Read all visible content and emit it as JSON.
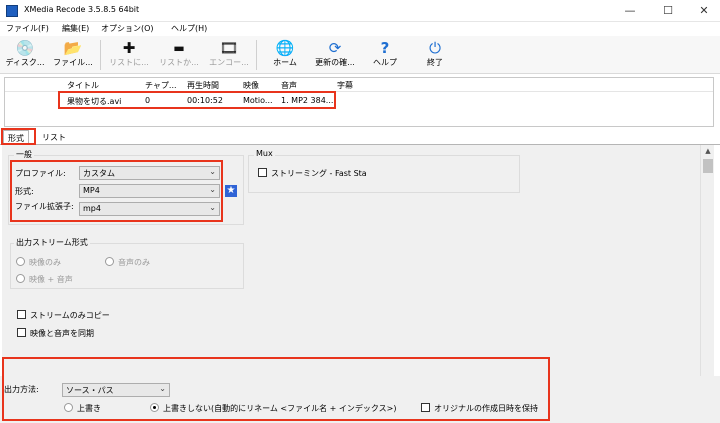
{
  "window": {
    "title": "XMedia Recode 3.5.8.5 64bit",
    "minimize": "—",
    "maximize": "☐",
    "close": "✕"
  },
  "menu": [
    "ファイル(F)",
    "編集(E)",
    "オプション(O)",
    "ヘルプ(H)"
  ],
  "toolbar": [
    {
      "icon": "disc-icon",
      "glyph": "💿",
      "label": "ディスク...",
      "enabled": true
    },
    {
      "icon": "file-open-icon",
      "glyph": "📂",
      "label": "ファイル...",
      "enabled": true
    },
    {
      "icon": "plus-icon",
      "glyph": "✚",
      "label": "リストに...",
      "enabled": false
    },
    {
      "icon": "minus-icon",
      "glyph": "▬",
      "label": "リストか...",
      "enabled": false
    },
    {
      "icon": "encode-icon",
      "glyph": "🎞",
      "label": "エンコー...",
      "enabled": false
    },
    {
      "icon": "globe-icon",
      "glyph": "🌐",
      "label": "ホーム",
      "enabled": true
    },
    {
      "icon": "refresh-icon",
      "glyph": "⟳",
      "label": "更新の確...",
      "enabled": true
    },
    {
      "icon": "help-icon",
      "glyph": "?",
      "label": "ヘルプ",
      "enabled": true
    },
    {
      "icon": "power-icon",
      "glyph": "⏻",
      "label": "終了",
      "enabled": true
    }
  ],
  "file_list": {
    "columns": [
      "タイトル",
      "チャプ...",
      "再生時間",
      "映像",
      "音声",
      "字幕"
    ],
    "rows": [
      [
        "果物を切る.avi",
        "0",
        "00:10:52",
        "Motio...",
        "1. MP2 384...",
        ""
      ]
    ]
  },
  "tabs": [
    "形式",
    "リスト"
  ],
  "general": {
    "title": "一般",
    "profile_label": "プロファイル:",
    "profile_value": "カスタム",
    "format_label": "形式:",
    "format_value": "MP4",
    "ext_label": "ファイル拡張子:",
    "ext_value": "mp4"
  },
  "mux": {
    "title": "Mux",
    "streaming_label": "ストリーミング - Fast Sta"
  },
  "output_stream": {
    "title": "出力ストリーム形式",
    "video_only": "映像のみ",
    "audio_only": "音声のみ",
    "video_audio": "映像 + 音声"
  },
  "stream_copy_label": "ストリームのみコピー",
  "sync_label": "映像と音声を同期",
  "output": {
    "method_label": "出力方法:",
    "method_value": "ソース・パス",
    "overwrite_label": "上書き",
    "no_overwrite_label": "上書きしない(自動的にリネーム <ファイル名 + インデックス>)",
    "keep_date_label": "オリジナルの作成日時を保持"
  },
  "colors": {
    "highlight": "#e8341c",
    "accent": "#2f63d6"
  }
}
